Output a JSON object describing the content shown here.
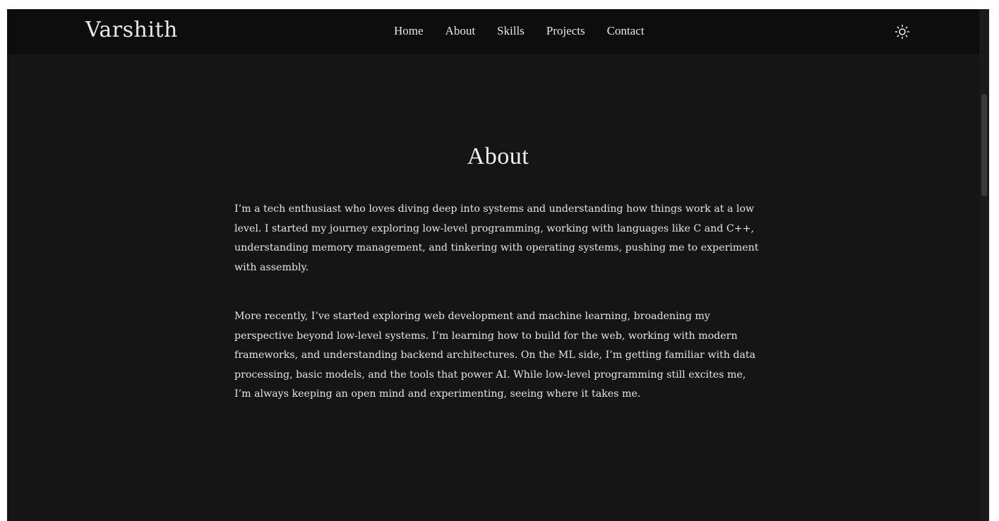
{
  "brand": "Varshith",
  "nav": {
    "links": [
      "Home",
      "About",
      "Skills",
      "Projects",
      "Contact"
    ]
  },
  "theme_toggle": {
    "icon": "sun-icon"
  },
  "about": {
    "title": "About",
    "paragraphs": [
      "I’m a tech enthusiast who loves diving deep into systems and understanding how things work at a low level. I started my journey exploring low-level programming, working with languages like C and C++, understanding memory management, and tinkering with operating systems, pushing me to experiment with assembly.",
      "More recently, I’ve started exploring web development and machine learning, broadening my perspective beyond low-level systems. I’m learning how to build for the web, working with modern frameworks, and understanding backend architectures. On the ML side, I’m getting familiar with data processing, basic models, and the tools that power AI. While low-level programming still excites me, I’m always keeping an open mind and experimenting, seeing where it takes me."
    ]
  },
  "colors": {
    "page_background": "#151515",
    "navbar_background": "#0d0d0d",
    "text": "#e4e4e4"
  }
}
